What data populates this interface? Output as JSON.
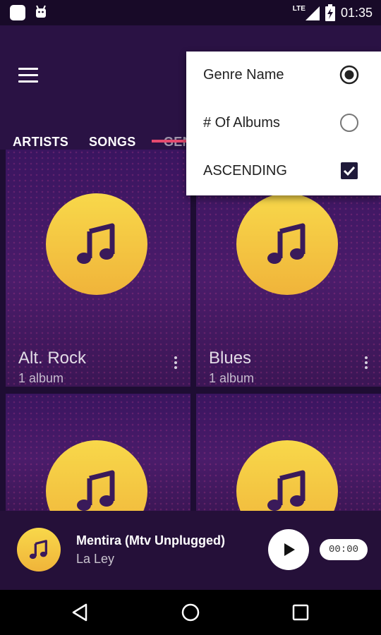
{
  "status_bar": {
    "network_label": "LTE",
    "time": "01:35",
    "icons": [
      "notification-square-icon",
      "android-bot-icon",
      "signal-icon",
      "battery-icon"
    ]
  },
  "header": {
    "menu_icon": "hamburger-menu-icon"
  },
  "tabs": [
    {
      "label": "ARTISTS"
    },
    {
      "label": "SONGS"
    },
    {
      "label": "GEN"
    }
  ],
  "sort_menu": {
    "items": [
      {
        "label": "Genre Name",
        "control": "radio",
        "checked": true
      },
      {
        "label": "# Of Albums",
        "control": "radio",
        "checked": false
      },
      {
        "label": "ASCENDING",
        "control": "checkbox",
        "checked": true
      }
    ]
  },
  "genres": [
    {
      "name": "Alt. Rock",
      "count": "1 album",
      "icon": "music-note-icon"
    },
    {
      "name": "Blues",
      "count": "1 album",
      "icon": "music-note-icon"
    },
    {
      "name": "",
      "count": "",
      "icon": "music-note-icon"
    },
    {
      "name": "",
      "count": "",
      "icon": "music-note-icon"
    }
  ],
  "now_playing": {
    "title": "Mentira (Mtv Unplugged)",
    "artist": "La Ley",
    "time": "00:00"
  },
  "colors": {
    "accent": "#e54a6f",
    "disc_yellow": "#f8d84a",
    "background": "#22103a"
  }
}
